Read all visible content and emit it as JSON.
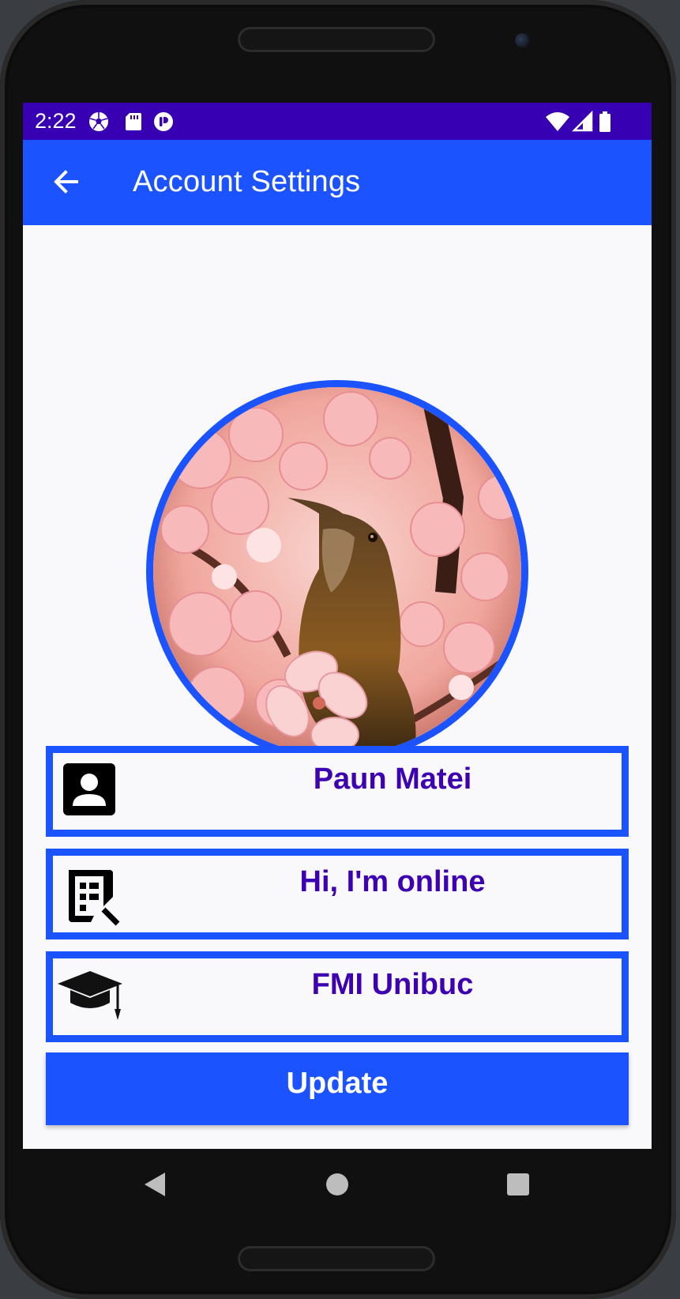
{
  "status_bar": {
    "time": "2:22",
    "background": "#3700b3",
    "left_icons": [
      "soccer-ball-icon",
      "sd-card-icon",
      "app-notification-icon"
    ],
    "right_icons": [
      "wifi-icon",
      "cell-signal-icon",
      "battery-icon"
    ]
  },
  "app_bar": {
    "title": "Account Settings",
    "background": "#1a53ff",
    "nav_icon": "arrow-back-icon"
  },
  "profile": {
    "image": "bird-among-pink-cherry-blossoms",
    "border_color": "#1a53ff"
  },
  "fields": [
    {
      "icon": "contact-card-icon",
      "value": "Paun Matei"
    },
    {
      "icon": "edit-status-icon",
      "value": "Hi, I'm online"
    },
    {
      "icon": "graduation-cap-icon",
      "value": "FMI Unibuc"
    }
  ],
  "update_button": {
    "label": "Update"
  },
  "colors": {
    "accent": "#1a53ff",
    "field_text": "#3d00b3",
    "background": "#f9f9fb"
  },
  "nav_bar": [
    "back-triangle-icon",
    "home-circle-icon",
    "recents-square-icon"
  ]
}
